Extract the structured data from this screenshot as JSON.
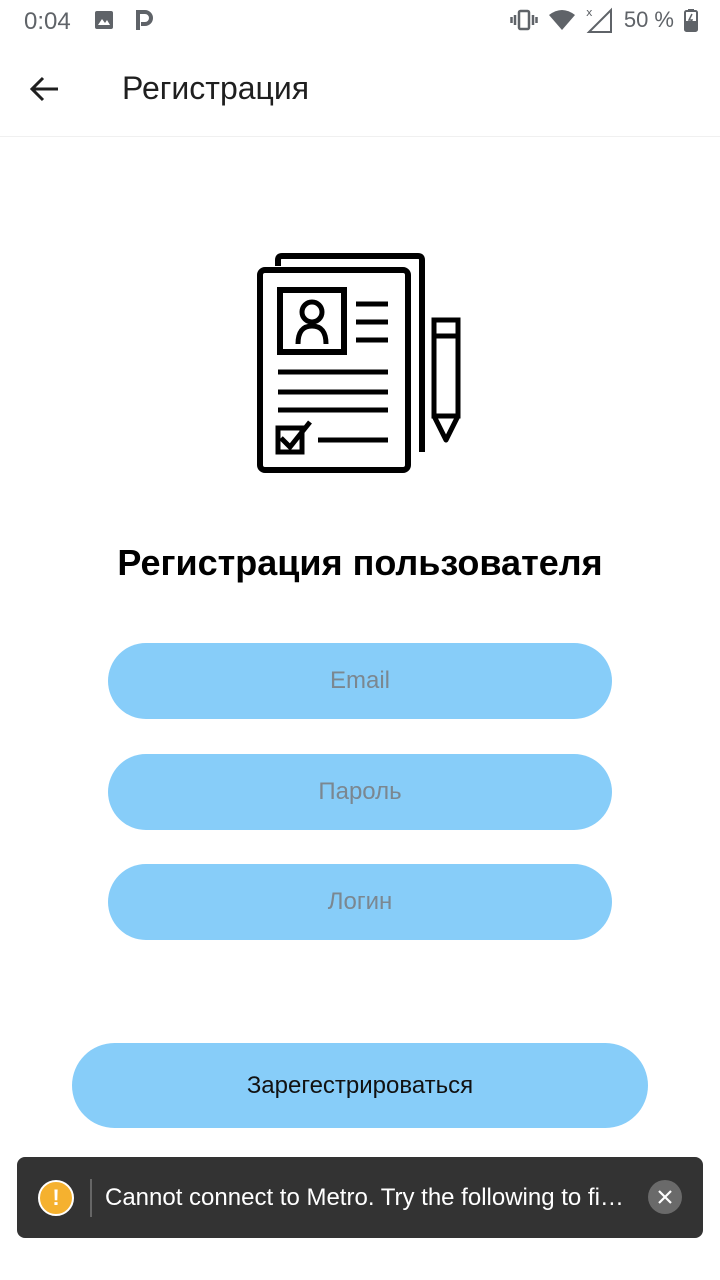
{
  "status_bar": {
    "time": "0:04",
    "battery": "50 %",
    "icons": [
      "image-icon",
      "p-app-icon",
      "vibrate-icon",
      "wifi-icon",
      "no-signal-icon",
      "battery-icon"
    ]
  },
  "app_bar": {
    "title": "Регистрация",
    "back_icon": "arrow-back-icon"
  },
  "main": {
    "illustration_icon": "registration-form-icon",
    "heading": "Регистрация пользователя",
    "fields": [
      {
        "placeholder": "Email",
        "value": ""
      },
      {
        "placeholder": "Пароль",
        "value": ""
      },
      {
        "placeholder": "Логин",
        "value": ""
      }
    ],
    "register_label": "Зарегестрироваться"
  },
  "toast": {
    "message": "Cannot connect to Metro.  Try the following to fix the issue:",
    "icon": "warning-icon",
    "close_icon": "close-icon"
  },
  "colors": {
    "accent": "#87cdf9",
    "toast_bg": "#333333",
    "warning": "#f5b12f"
  }
}
